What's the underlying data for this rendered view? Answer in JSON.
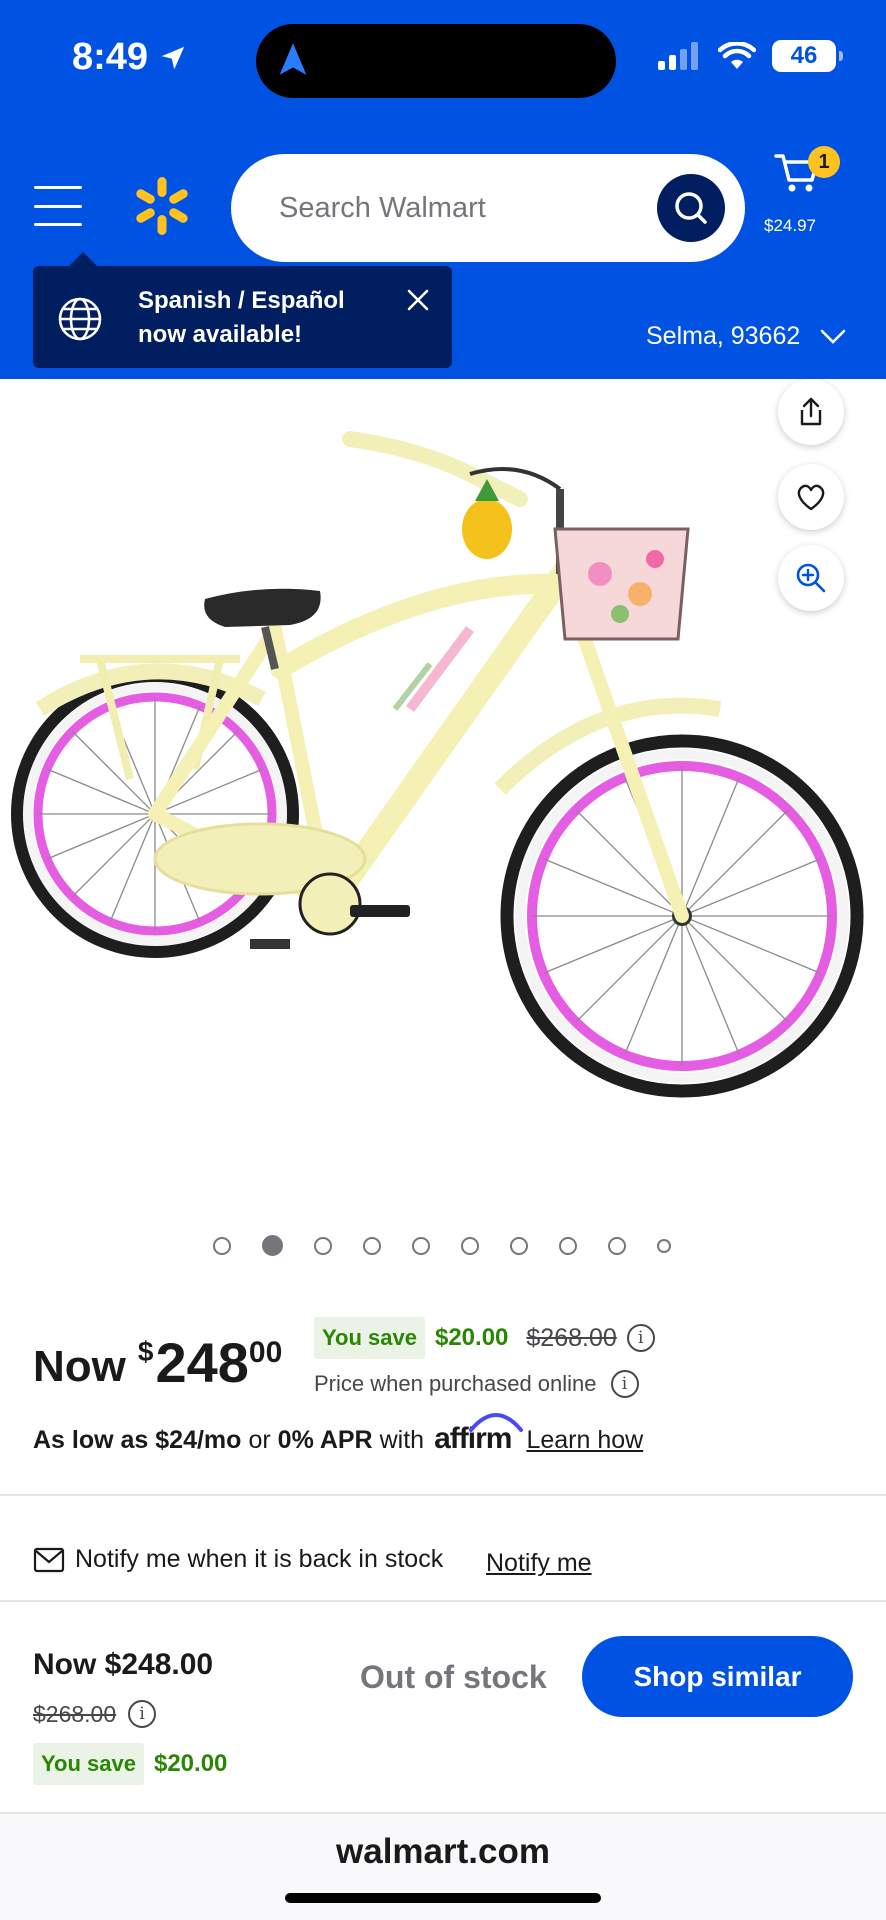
{
  "status_bar": {
    "time": "8:49",
    "battery": "46"
  },
  "header": {
    "search_placeholder": "Search Walmart",
    "cart_count": "1",
    "cart_total": "$24.97",
    "tooltip_text": "Spanish / Español now available!",
    "location": "Selma, 93662"
  },
  "colors": {
    "brand_blue": "#0053e2",
    "navy": "#001e60",
    "spark_yellow": "#ffc220",
    "save_green": "#2a8703"
  },
  "product": {
    "image_alt": "Yellow cruiser bicycle with pink rims and floral basket",
    "image_count": 10,
    "active_image_index": 1
  },
  "price": {
    "now_label": "Now",
    "currency": "$",
    "dollars": "248",
    "cents": "00",
    "you_save_label": "You save",
    "save_amount": "$20.00",
    "was_price": "$268.00",
    "online_note": "Price when purchased online",
    "affirm_low": "As low as $24/mo",
    "affirm_or": "or",
    "affirm_apr": "0% APR",
    "affirm_with": "with",
    "affirm_logo": "affirm",
    "learn_how": "Learn how"
  },
  "stock": {
    "notify_text": "Notify me when it is back in stock",
    "notify_link": "Notify me"
  },
  "bottom_bar": {
    "now_price": "Now $248.00",
    "was_price": "$268.00",
    "you_save_label": "You save",
    "save_amount": "$20.00",
    "out_of_stock": "Out of stock",
    "shop_similar": "Shop similar"
  },
  "browser": {
    "url": "walmart.com"
  }
}
